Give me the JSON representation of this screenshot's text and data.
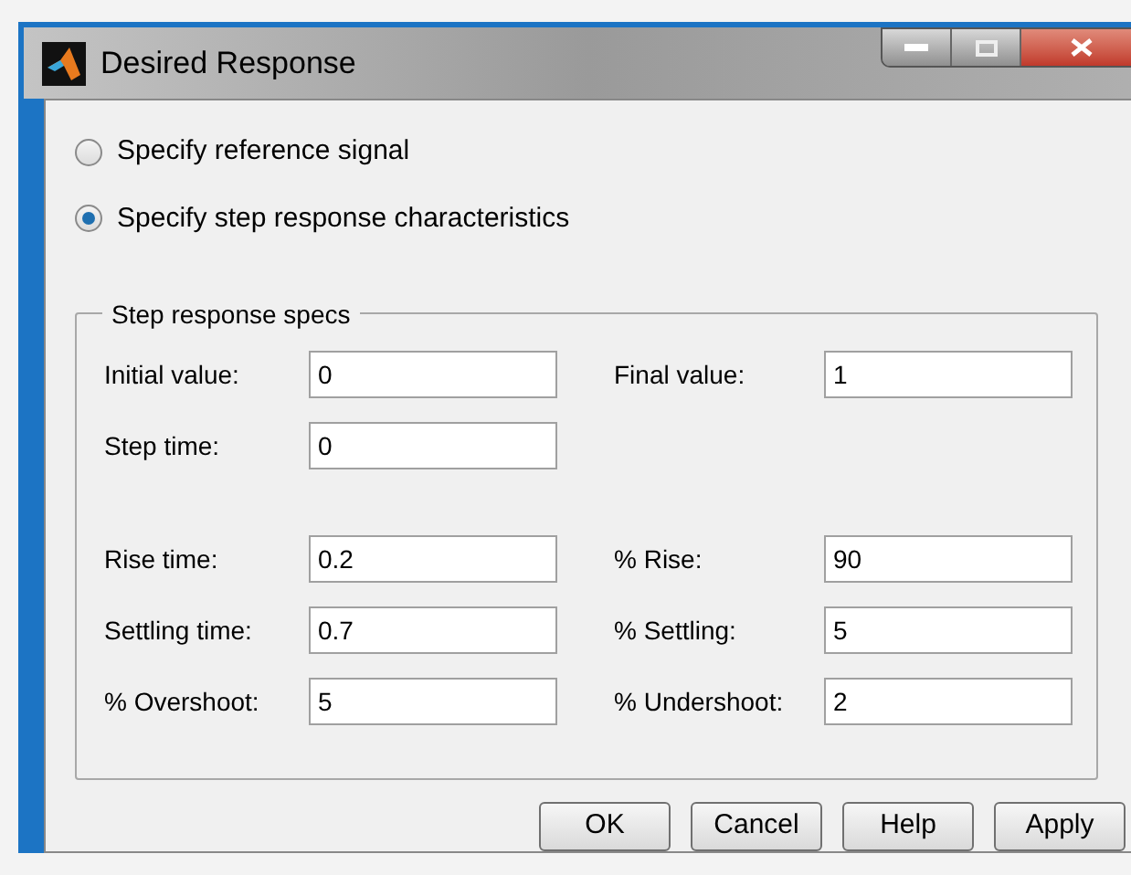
{
  "window": {
    "title": "Desired Response"
  },
  "options": [
    {
      "label": "Specify reference signal",
      "selected": false
    },
    {
      "label": "Specify step response characteristics",
      "selected": true
    }
  ],
  "group": {
    "title": "Step response specs",
    "sections": [
      {
        "rows": [
          [
            {
              "label": "Initial value:",
              "value": "0"
            },
            {
              "label": "Final value:",
              "value": "1"
            }
          ],
          [
            {
              "label": "Step time:",
              "value": "0"
            }
          ]
        ]
      },
      {
        "rows": [
          [
            {
              "label": "Rise time:",
              "value": "0.2"
            },
            {
              "label": "% Rise:",
              "value": "90"
            }
          ],
          [
            {
              "label": "Settling time:",
              "value": "0.7"
            },
            {
              "label": "% Settling:",
              "value": "5"
            }
          ],
          [
            {
              "label": "% Overshoot:",
              "value": "5"
            },
            {
              "label": "% Undershoot:",
              "value": "2"
            }
          ]
        ]
      }
    ]
  },
  "buttons": [
    "OK",
    "Cancel",
    "Help",
    "Apply"
  ]
}
